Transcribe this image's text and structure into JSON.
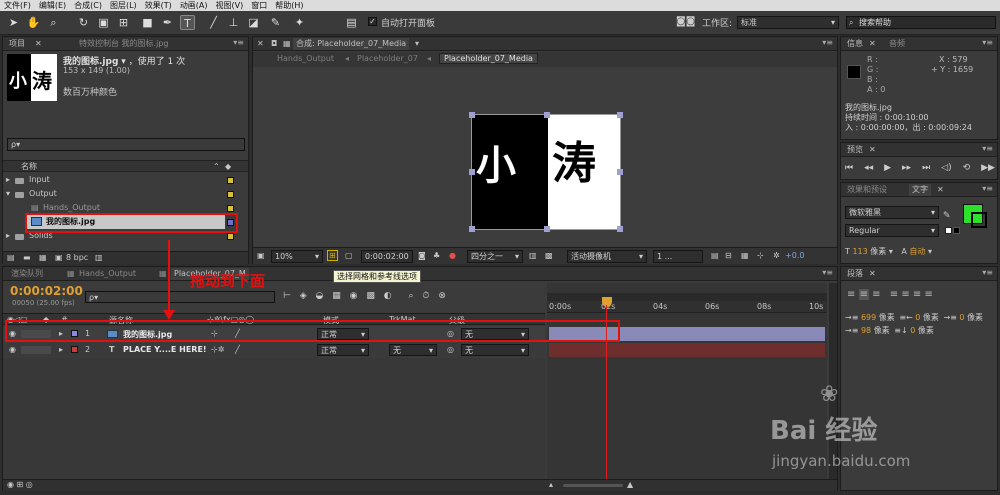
{
  "menu": [
    "文件(F)",
    "编辑(E)",
    "合成(C)",
    "图层(L)",
    "效果(T)",
    "动画(A)",
    "视图(V)",
    "窗口",
    "帮助(H)"
  ],
  "toolbar": {
    "auto_open_panel_label": "自动打开面板",
    "workspace_label": "工作区:",
    "workspace_value": "标准",
    "search_help_placeholder": "搜索帮助"
  },
  "project": {
    "tab_project": "项目",
    "tab_effects": "特效控制台 我的图标.jpg",
    "item_name": "我的图标.jpg",
    "used_count": "，使用了 1 次",
    "dimensions": "153 x 149 (1.00)",
    "colors": "数百万种颜色",
    "search_placeholder": "ρ▾",
    "col_name": "名称",
    "items": [
      {
        "label": "Input",
        "type": "folder",
        "color": "#d4c23a"
      },
      {
        "label": "Output",
        "type": "folder",
        "color": "#d4c23a"
      },
      {
        "label": "Hands_Output",
        "type": "comp",
        "color": "#d4c23a"
      },
      {
        "label": "我的图标.jpg",
        "type": "image",
        "color": "#7070c8"
      },
      {
        "label": "Solids",
        "type": "folder",
        "color": "#d4c23a"
      }
    ],
    "bpc": "8 bpc"
  },
  "composition": {
    "tab_title": "合成: Placeholder_07_Media",
    "breadcrumbs": [
      "Hands_Output",
      "Placeholder_07",
      "Placeholder_07_Media"
    ],
    "zoom": "10%",
    "timecode": "0:00:02:00",
    "resolution": "四分之一",
    "camera": "活动摄像机",
    "views": "1 ...",
    "exposure": "+0.0",
    "tooltip": "选择网格和参考线选项"
  },
  "info": {
    "tab_info": "信息",
    "tab_audio": "音频",
    "r": "R :",
    "g": "G :",
    "b": "B :",
    "a": "A : 0",
    "x": "X : 579",
    "y": "+ Y : 1659",
    "name": "我的图标.jpg",
    "duration": "持续时间 : 0:00:10:00",
    "in_out": "入 : 0:00:00:00，出 : 0:00:09:24"
  },
  "preview": {
    "tab": "预览"
  },
  "effects_presets": {
    "tab_effects": "效果和预设",
    "tab_text": "文字"
  },
  "character": {
    "font": "微软雅黑",
    "style": "Regular",
    "size_value": "113",
    "unit": "像素",
    "leading": "自动"
  },
  "paragraph": {
    "tab": "段落",
    "indent_left": "699",
    "indent_right": "0",
    "first_line": "98",
    "space_before": "0",
    "space_after": "0",
    "unit": "像素"
  },
  "timeline": {
    "tab_render": "渲染队列",
    "tab_hands": "Hands_Output",
    "tab_place": "Placeholder_07_M",
    "timecode": "0:00:02:00",
    "fps": "00050 (25.00 fps)",
    "col_source": "源名称",
    "col_mode": "模式",
    "col_trkmat": "TrkMat",
    "col_parent": "父级",
    "ruler": [
      "0:00s",
      "02s",
      "04s",
      "06s",
      "08s",
      "10s"
    ],
    "layers": [
      {
        "num": "1",
        "name": "我的图标.jpg",
        "mode": "正常",
        "trkmat": "",
        "parent": "无",
        "color": "#8a8ae0"
      },
      {
        "num": "2",
        "name": "PLACE Y....E HERE!",
        "mode": "正常",
        "trkmat": "无",
        "parent": "无",
        "color": "#c83c3c"
      }
    ]
  },
  "annotation": "拖动到下面",
  "watermark": {
    "brand": "Bai 经验",
    "url": "jingyan.baidu.com"
  }
}
